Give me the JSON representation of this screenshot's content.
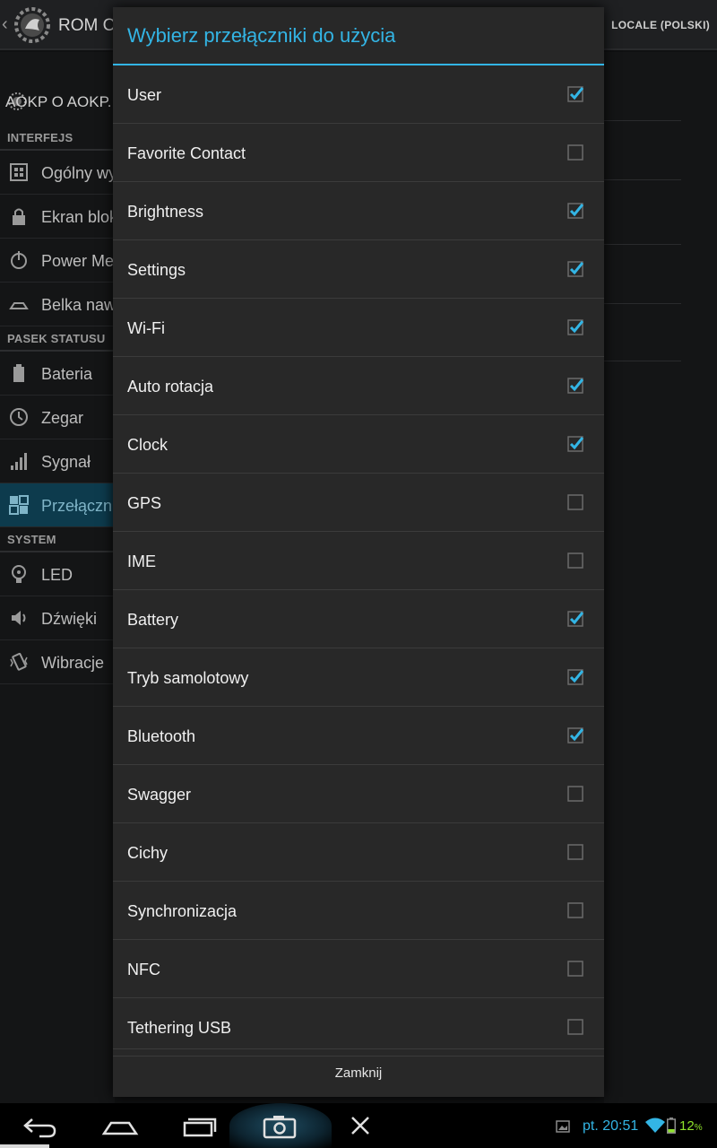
{
  "app_bar": {
    "title": "ROM Co",
    "locale": "LOCALE (POLSKI)"
  },
  "sidebar": {
    "header_text": "AOKP  O AOKP.",
    "sections": [
      {
        "title": "INTERFEJS",
        "items": [
          {
            "label": "Ogólny wy",
            "icon": "general-icon"
          },
          {
            "label": "Ekran blok",
            "icon": "lock-icon"
          },
          {
            "label": "Power Me",
            "icon": "power-icon"
          },
          {
            "label": "Belka naw",
            "icon": "navbar-icon"
          }
        ]
      },
      {
        "title": "PASEK STATUSU",
        "items": [
          {
            "label": "Bateria",
            "icon": "battery-icon"
          },
          {
            "label": "Zegar",
            "icon": "clock-icon"
          },
          {
            "label": "Sygnał",
            "icon": "signal-icon"
          },
          {
            "label": "Przełączn",
            "icon": "toggles-icon",
            "active": true
          }
        ]
      },
      {
        "title": "SYSTEM",
        "items": [
          {
            "label": "LED",
            "icon": "led-icon"
          },
          {
            "label": "Dźwięki",
            "icon": "sound-icon"
          },
          {
            "label": "Wibracje",
            "icon": "vibrate-icon"
          }
        ]
      }
    ]
  },
  "dialog": {
    "title": "Wybierz przełączniki do użycia",
    "items": [
      {
        "label": "User",
        "checked": true
      },
      {
        "label": "Favorite Contact",
        "checked": false
      },
      {
        "label": "Brightness",
        "checked": true
      },
      {
        "label": "Settings",
        "checked": true
      },
      {
        "label": "Wi-Fi",
        "checked": true
      },
      {
        "label": "Auto rotacja",
        "checked": true
      },
      {
        "label": "Clock",
        "checked": true
      },
      {
        "label": "GPS",
        "checked": false
      },
      {
        "label": "IME",
        "checked": false
      },
      {
        "label": "Battery",
        "checked": true
      },
      {
        "label": "Tryb samolotowy",
        "checked": true
      },
      {
        "label": "Bluetooth",
        "checked": true
      },
      {
        "label": "Swagger",
        "checked": false
      },
      {
        "label": "Cichy",
        "checked": false
      },
      {
        "label": "Synchronizacja",
        "checked": false
      },
      {
        "label": "NFC",
        "checked": false
      },
      {
        "label": "Tethering USB",
        "checked": false
      }
    ],
    "close_label": "Zamknij"
  },
  "navbar": {
    "time": "pt. 20:51",
    "battery_value": "12",
    "battery_unit": "%"
  },
  "colors": {
    "accent": "#33b5e5",
    "battery": "#8fe32b",
    "dialog_bg": "#282828"
  }
}
